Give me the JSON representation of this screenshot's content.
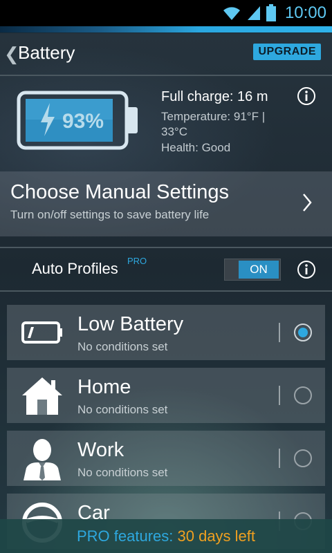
{
  "status_bar": {
    "time": "10:00",
    "icons": [
      "wifi-icon",
      "signal-icon",
      "battery-icon"
    ]
  },
  "header": {
    "back_icon": "chevron-left-icon",
    "title": "Battery",
    "upgrade_label": "UPGRADE"
  },
  "battery": {
    "percent_label": "93%",
    "full_charge": "Full charge: 16 m",
    "temperature": "Temperature: 91°F | 33°C",
    "health": "Health: Good"
  },
  "manual_settings": {
    "title": "Choose Manual Settings",
    "subtitle": "Turn on/off settings to save battery life"
  },
  "auto_profiles": {
    "label": "Auto Profiles",
    "pro_tag": "PRO",
    "toggle_label": "ON"
  },
  "profiles": [
    {
      "name": "Low Battery",
      "subtitle": "No conditions set",
      "selected": true,
      "icon": "low-battery-icon"
    },
    {
      "name": "Home",
      "subtitle": "No conditions set",
      "selected": false,
      "icon": "home-icon"
    },
    {
      "name": "Work",
      "subtitle": "No conditions set",
      "selected": false,
      "icon": "person-icon"
    },
    {
      "name": "Car",
      "subtitle": "",
      "selected": false,
      "icon": "steering-wheel-icon"
    }
  ],
  "footer": {
    "prefix": "PRO features:",
    "days_left": "30 days left"
  },
  "colors": {
    "accent": "#2ea8df",
    "warning": "#f0a020"
  }
}
